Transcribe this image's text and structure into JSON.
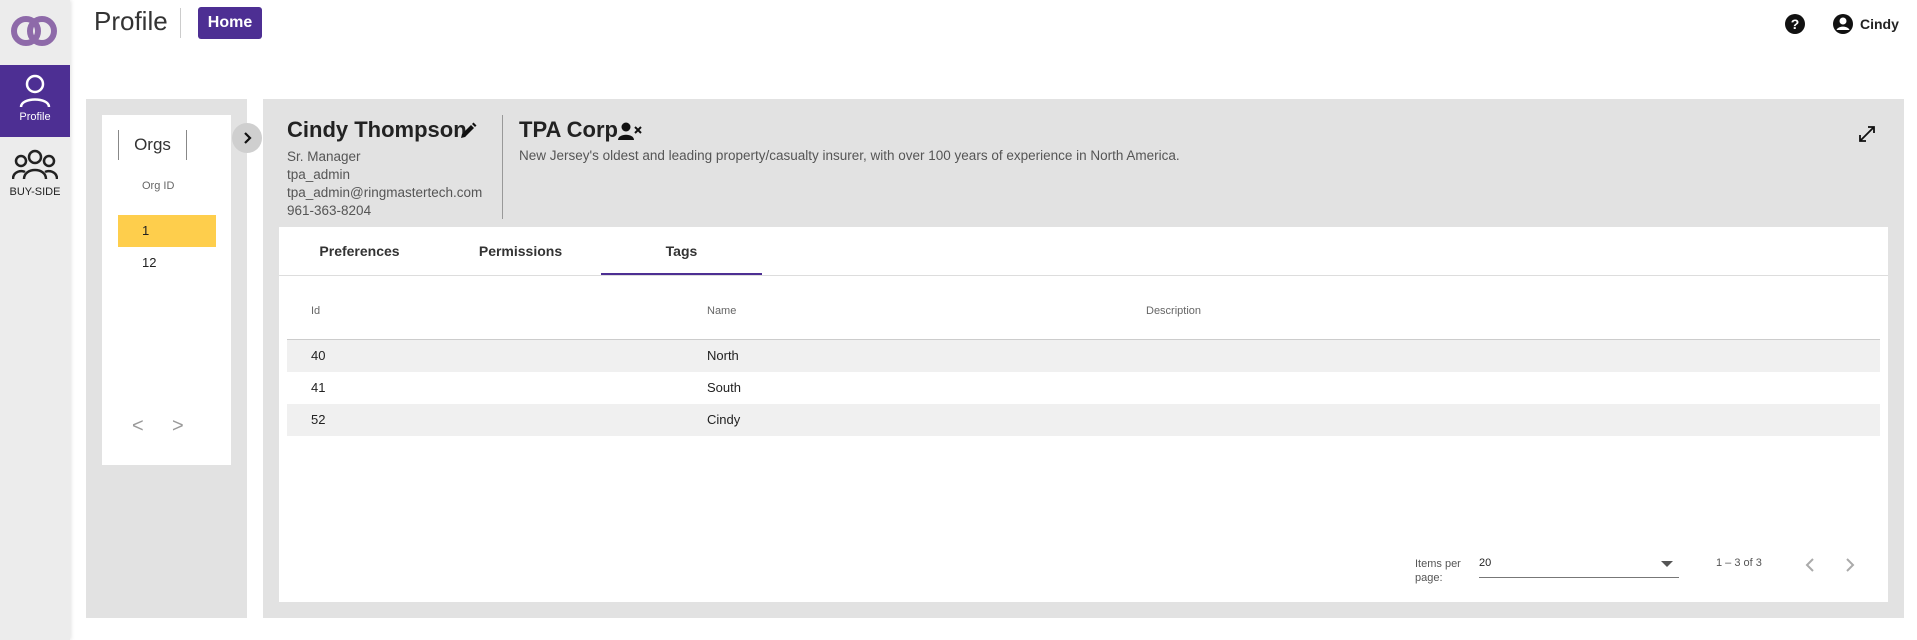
{
  "nav": {
    "items": [
      {
        "label": "Profile",
        "icon": "user-icon",
        "active": true
      },
      {
        "label": "BUY-SIDE",
        "icon": "group-icon",
        "active": false
      }
    ]
  },
  "header": {
    "title": "Profile",
    "home_label": "Home",
    "user_name": "Cindy"
  },
  "orgs": {
    "tab_label": "Orgs",
    "column": "Org ID",
    "rows": [
      "1",
      "12"
    ],
    "selected": "1",
    "prev": "<",
    "next": ">"
  },
  "person": {
    "name": "Cindy Thompson",
    "title": "Sr. Manager",
    "username": "tpa_admin",
    "email": "tpa_admin@ringmastertech.com",
    "phone": "961-363-8204"
  },
  "organization": {
    "name": "TPA Corp",
    "description": "New Jersey's oldest and leading property/casualty insurer, with over 100 years of experience in North America."
  },
  "tabs": [
    "Preferences",
    "Permissions",
    "Tags"
  ],
  "active_tab": "Tags",
  "table": {
    "columns": [
      "Id",
      "Name",
      "Description"
    ],
    "rows": [
      {
        "id": "40",
        "name": "North",
        "description": ""
      },
      {
        "id": "41",
        "name": "South",
        "description": ""
      },
      {
        "id": "52",
        "name": "Cindy",
        "description": ""
      }
    ]
  },
  "paginator": {
    "items_per_page_label": "Items per page:",
    "items_per_page": "20",
    "range": "1 – 3 of 3"
  },
  "colors": {
    "accent": "#4d2f93",
    "selected_row": "#fece4c"
  }
}
